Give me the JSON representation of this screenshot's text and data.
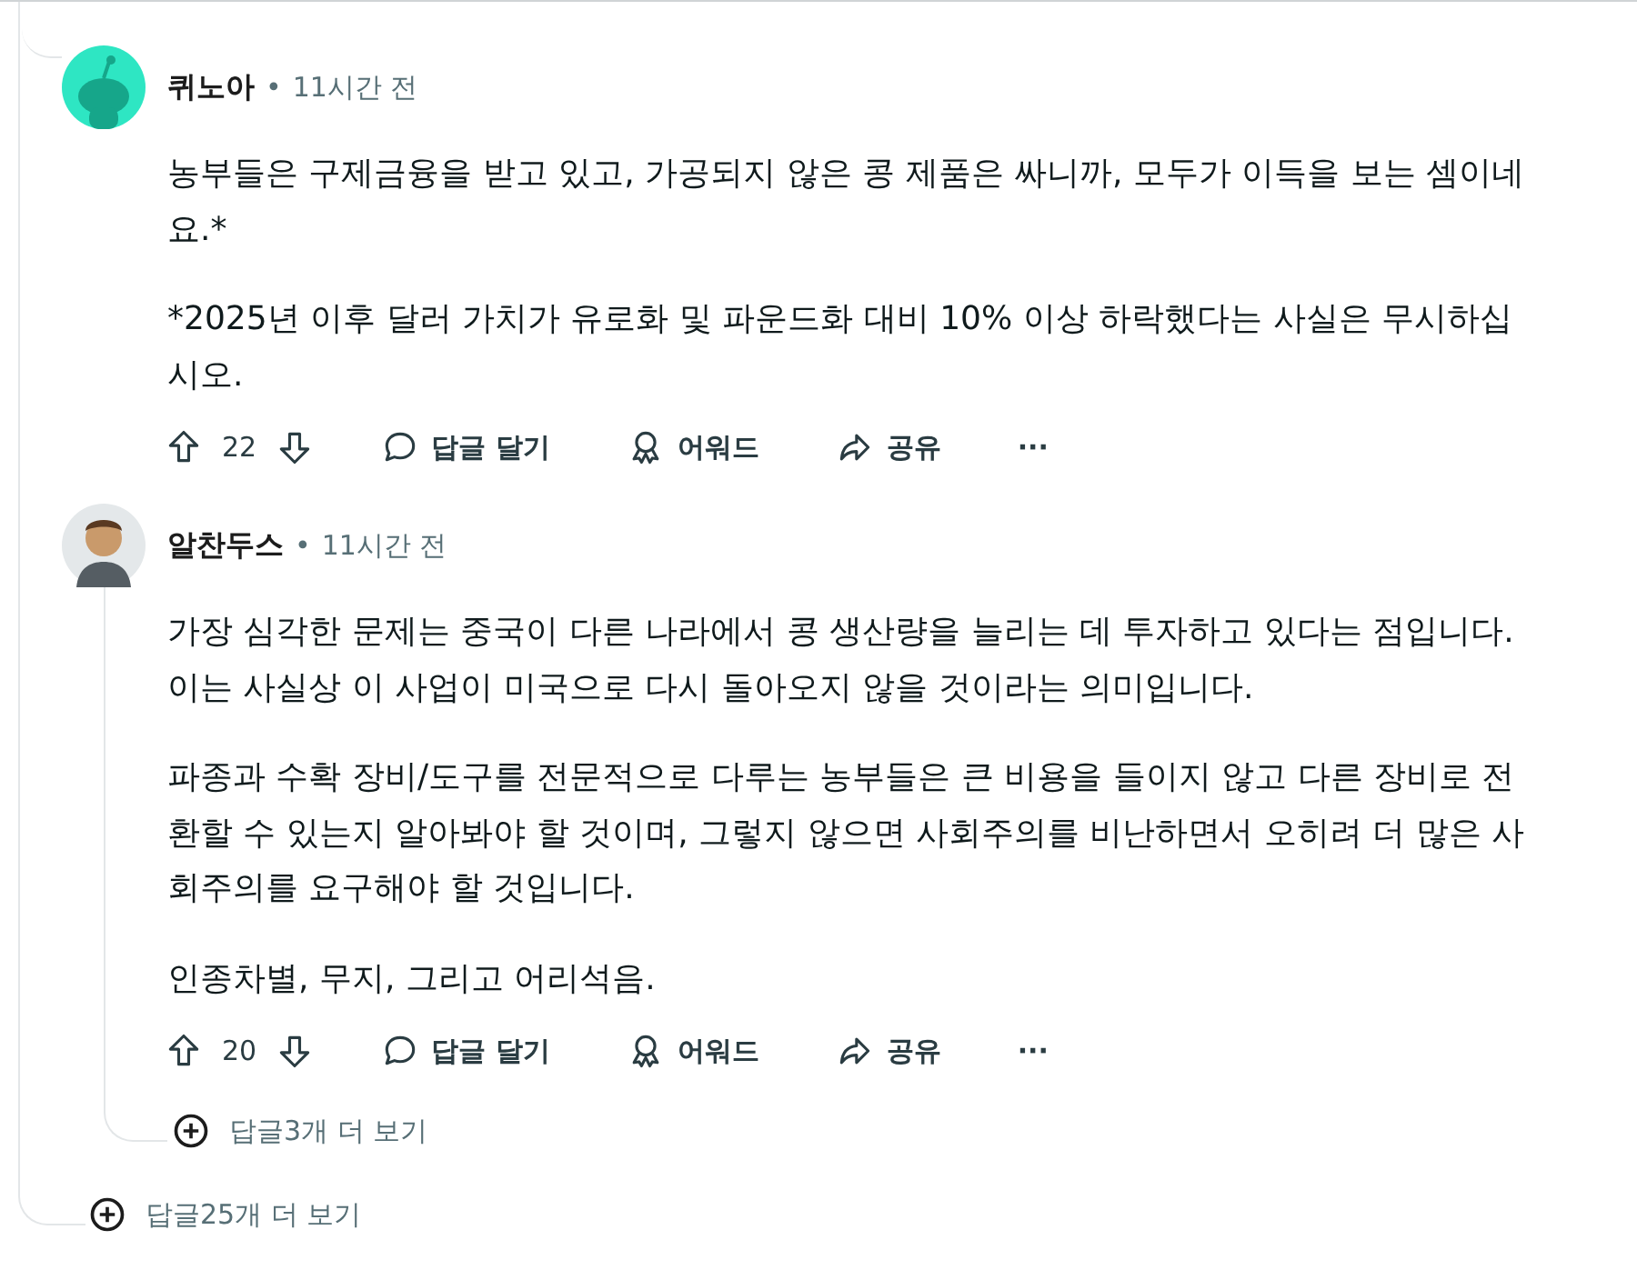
{
  "comments": [
    {
      "author": "퀴노아",
      "separator": "•",
      "time": "11시간 전",
      "avatar": {
        "kind": "snoo"
      },
      "paragraphs": [
        "농부들은 구제금융을 받고 있고, 가공되지 않은 콩 제품은 싸니까, 모두가 이득을 보는 셈이네요.*",
        "*2025년 이후 달러 가치가 유로화 및 파운드화 대비 10% 이상 하락했다는 사실은 무시하십시오."
      ],
      "votes": "22",
      "reply": "답글 달기",
      "award": "어워드",
      "share": "공유",
      "more": "···"
    },
    {
      "author": "알찬두스",
      "separator": "•",
      "time": "11시간 전",
      "avatar": {
        "kind": "figure"
      },
      "paragraphs": [
        "가장 심각한 문제는 중국이 다른 나라에서 콩 생산량을 늘리는 데 투자하고 있다는 점입니다. 이는 사실상 이 사업이 미국으로 다시 돌아오지 않을 것이라는 의미입니다.",
        "파종과 수확 장비/도구를 전문적으로 다루는 농부들은 큰 비용을 들이지 않고 다른 장비로 전환할 수 있는지 알아봐야 할 것이며, 그렇지 않으면 사회주의를 비난하면서 오히려 더 많은 사회주의를 요구해야 할 것입니다.",
        "인종차별, 무지, 그리고 어리석음."
      ],
      "votes": "20",
      "reply": "답글 달기",
      "award": "어워드",
      "share": "공유",
      "more": "···",
      "more_replies": "답글3개 더 보기"
    }
  ],
  "more_replies": "답글25개 더 보기"
}
